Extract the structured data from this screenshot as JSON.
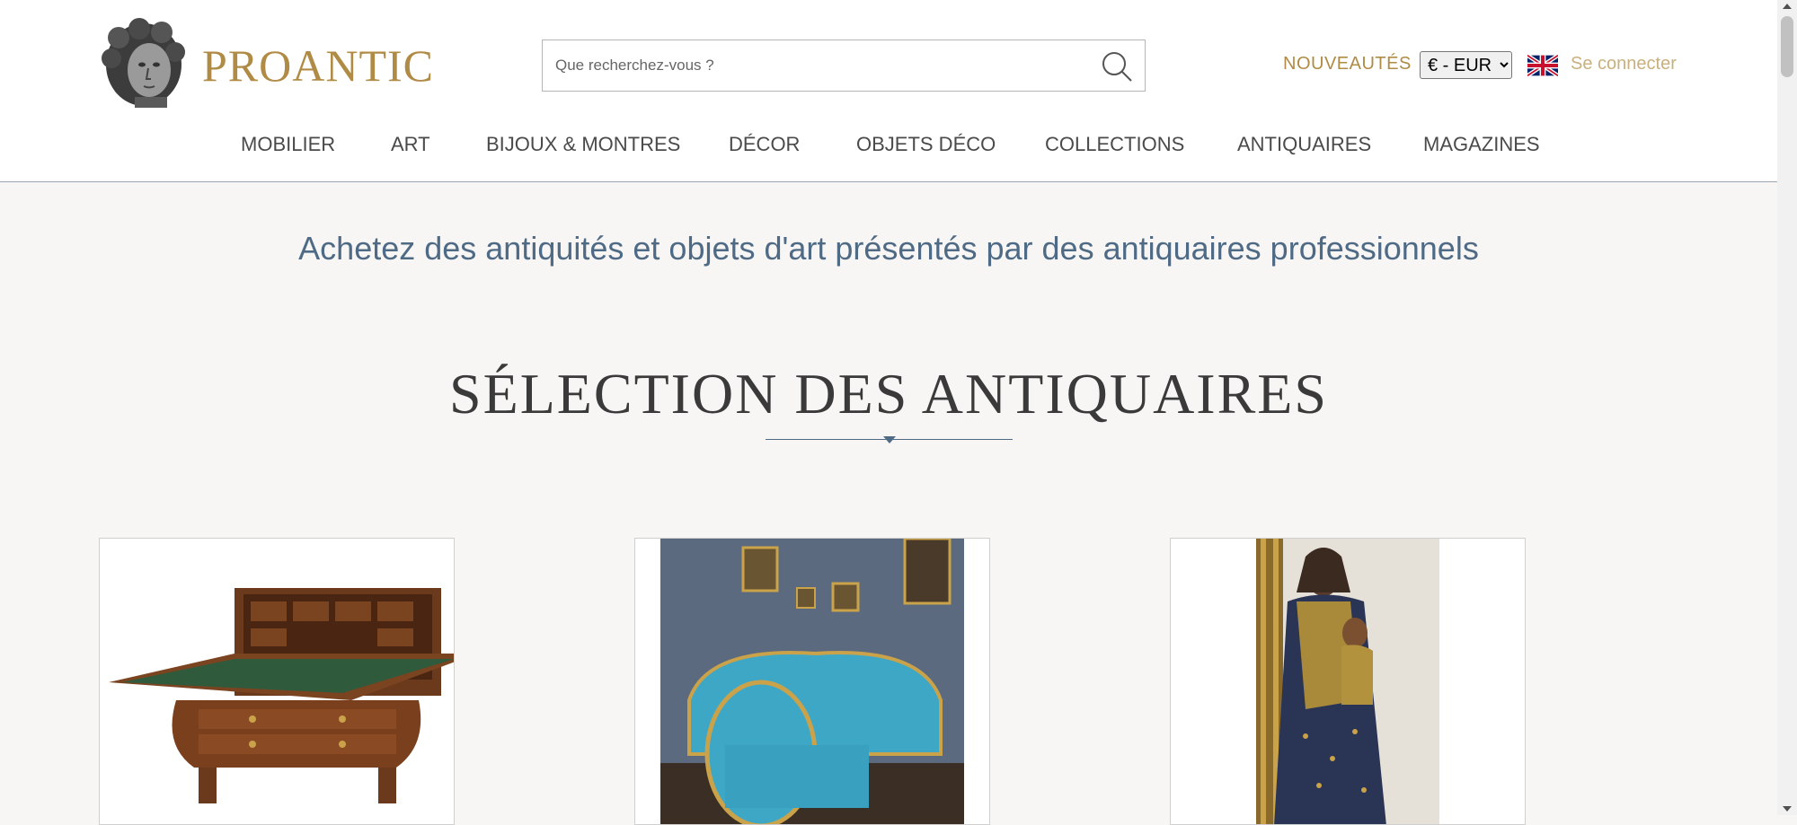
{
  "header": {
    "logo_text": "PROANTIC",
    "search": {
      "placeholder": "Que recherchez-vous ?",
      "value": "",
      "icon": "search-icon"
    },
    "nouveautes_label": "NOUVEAUTÉS",
    "currency": {
      "selected": "€ - EUR",
      "options": [
        "€ - EUR"
      ]
    },
    "language_flag": "uk-flag-icon",
    "login_label": "Se connecter"
  },
  "nav": {
    "items": [
      {
        "label": "MOBILIER"
      },
      {
        "label": "ART"
      },
      {
        "label": "BIJOUX & MONTRES"
      },
      {
        "label": "DÉCOR"
      },
      {
        "label": "OBJETS DÉCO"
      },
      {
        "label": "COLLECTIONS"
      },
      {
        "label": "ANTIQUAIRES"
      },
      {
        "label": "MAGAZINES"
      }
    ]
  },
  "main": {
    "tagline": "Achetez des antiquités et objets d'art présentés par des antiquaires professionnels",
    "section_title": "SÉLECTION DES ANTIQUAIRES",
    "cards": [
      {
        "image": "secretary-desk-image"
      },
      {
        "image": "blue-salon-image"
      },
      {
        "image": "madonna-statue-image"
      }
    ]
  },
  "colors": {
    "brand_gold": "#b08b45",
    "accent_blue": "#4f6a85",
    "background": "#f7f6f4"
  }
}
